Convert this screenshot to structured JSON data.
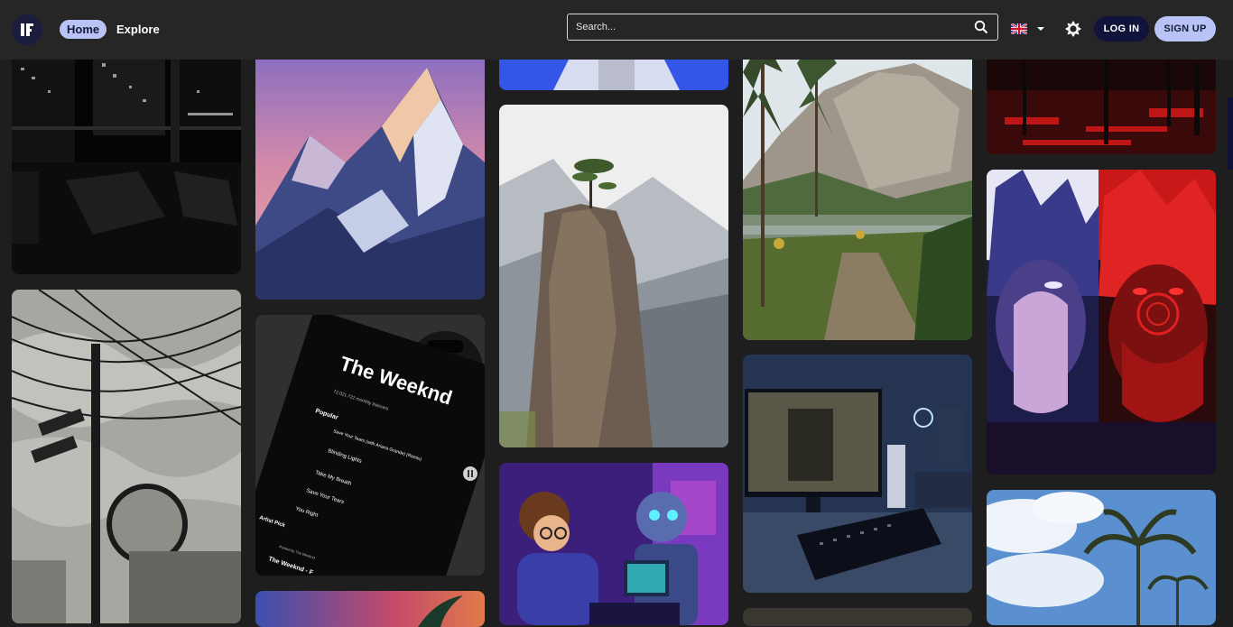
{
  "header": {
    "nav": {
      "home": "Home",
      "explore": "Explore"
    },
    "search_placeholder": "Search...",
    "language": "English (UK)",
    "login": "LOG IN",
    "signup": "SIGN UP"
  },
  "pins": [
    {
      "column": 1,
      "subject": "city-at-night"
    },
    {
      "column": 1,
      "subject": "power-lines-manga"
    },
    {
      "column": 2,
      "subject": "snowy-mountain-pink-sky"
    },
    {
      "column": 2,
      "subject": "spotify-the-weeknd",
      "artist": "The Weeknd",
      "listeners": "72,021,722 monthly listeners",
      "follow": "Following",
      "section": "Popular",
      "tracks": [
        "Save Your Tears (with Ariana Grande) (Remix)",
        "Blinding Lights",
        "Take My Breath",
        "Save Your Tears",
        "You Right"
      ],
      "pick_label": "Artist Pick",
      "posted_by": "Posted by The Weeknd",
      "footer": "The Weeknd - F"
    },
    {
      "column": 2,
      "subject": "palm-tree-sunset"
    },
    {
      "column": 3,
      "subject": "person-blue-background"
    },
    {
      "column": 3,
      "subject": "rock-spire-with-tree"
    },
    {
      "column": 3,
      "subject": "boy-and-robot-computer"
    },
    {
      "column": 4,
      "subject": "mountain-lake-forest"
    },
    {
      "column": 4,
      "subject": "gaming-desk-setup"
    },
    {
      "column": 5,
      "subject": "red-dark-anime-scene"
    },
    {
      "column": 5,
      "subject": "anime-characters-face"
    },
    {
      "column": 5,
      "subject": "palm-trees-blue-sky"
    }
  ]
}
